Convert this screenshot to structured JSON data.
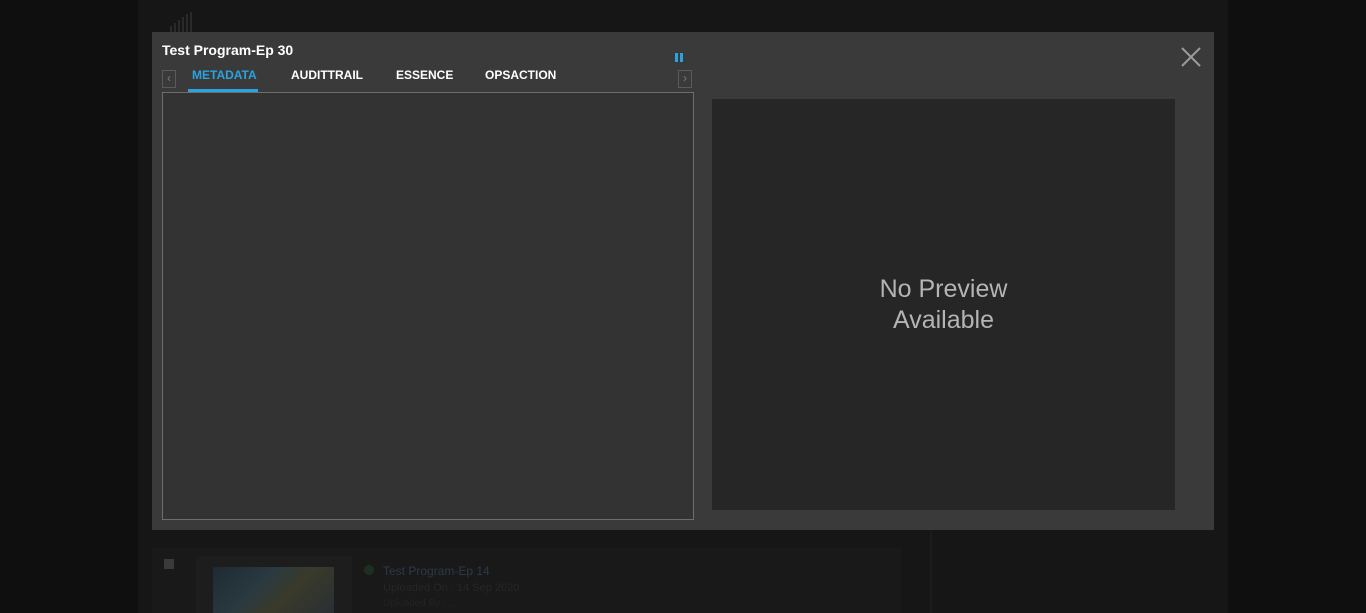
{
  "modal": {
    "title": "Test Program-Ep 30",
    "tabs": [
      {
        "label": "METADATA",
        "active": true
      },
      {
        "label": "AUDITTRAIL",
        "active": false
      },
      {
        "label": "ESSENCE",
        "active": false
      },
      {
        "label": "OPSACTION",
        "active": false
      }
    ],
    "tab_scroll_left_icon": "chevron-left-icon",
    "tab_scroll_right_icon": "chevron-right-icon",
    "close_icon": "close-icon",
    "pause_icon": "pause-icon",
    "preview": {
      "message": "No Preview\nAvailable"
    }
  },
  "background": {
    "item": {
      "title": "Test Program-Ep 14",
      "uploaded": "Uploaded On : 14 Sep 2020",
      "extra": "Uploaded By : ..."
    }
  },
  "colors": {
    "accent": "#2aa3e0",
    "modal_bg": "#3a3a3a",
    "preview_bg": "#262626",
    "page_bg": "#0f0f0f"
  }
}
